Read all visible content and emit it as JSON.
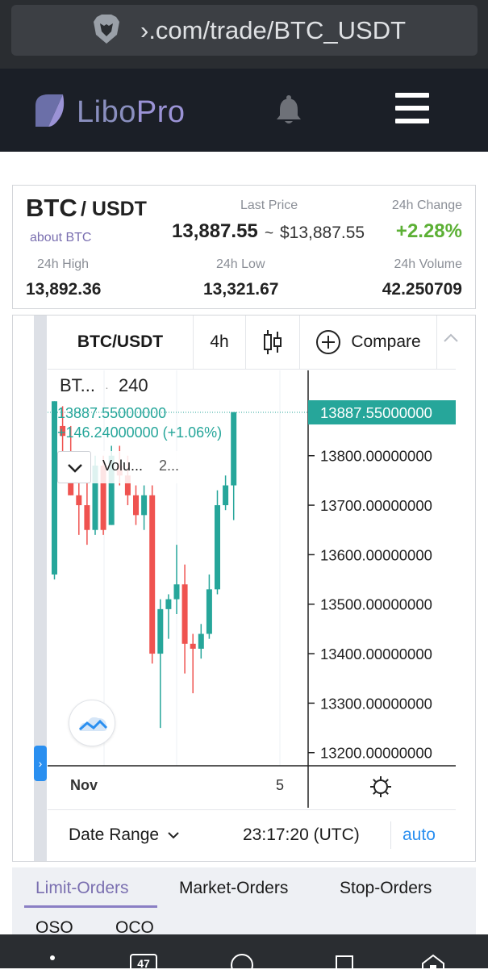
{
  "browser": {
    "url": "›.com/trade/BTC_USDT"
  },
  "site": {
    "logo_main": "Libo",
    "logo_accent": "Pro"
  },
  "ticker": {
    "base": "BTC",
    "quote": "/ USDT",
    "about": "about BTC",
    "last_price_label": "Last Price",
    "last_price": "13,887.55",
    "tilde": "~",
    "usd_price": "$13,887.55",
    "change_label": "24h Change",
    "change": "+2.28%",
    "high_label": "24h High",
    "high": "13,892.36",
    "low_label": "24h Low",
    "low": "13,321.67",
    "volume_label": "24h Volume",
    "volume": "42.250709"
  },
  "chart_toolbar": {
    "symbol": "BTC/USDT",
    "interval": "4h",
    "compare": "Compare"
  },
  "chart_legend": {
    "symbol_short": "BT...",
    "interval": "240",
    "price": "13887.55000000",
    "change": "+146.24000000 (+1.06%)",
    "volume_label": "Volu...",
    "volume_value": "2..."
  },
  "chart_data": {
    "type": "candlestick",
    "price_tag": "13887.55000000",
    "y_ticks": [
      "13800.00000000",
      "13700.00000000",
      "13600.00000000",
      "13500.00000000",
      "13400.00000000",
      "13300.00000000",
      "13200.00000000"
    ],
    "x_ticks": [
      "Nov",
      "5"
    ],
    "ylim": [
      13180,
      13930
    ],
    "candles": [
      {
        "o": 13560,
        "h": 13910,
        "l": 13550,
        "c": 13910
      },
      {
        "o": 13860,
        "h": 13900,
        "l": 13800,
        "c": 13840
      },
      {
        "o": 13790,
        "h": 13860,
        "l": 13720,
        "c": 13720
      },
      {
        "o": 13720,
        "h": 13760,
        "l": 13640,
        "c": 13700
      },
      {
        "o": 13700,
        "h": 13760,
        "l": 13620,
        "c": 13650
      },
      {
        "o": 13650,
        "h": 13800,
        "l": 13640,
        "c": 13780
      },
      {
        "o": 13780,
        "h": 13800,
        "l": 13640,
        "c": 13650
      },
      {
        "o": 13660,
        "h": 13820,
        "l": 13660,
        "c": 13800
      },
      {
        "o": 13780,
        "h": 13820,
        "l": 13740,
        "c": 13760
      },
      {
        "o": 13760,
        "h": 13800,
        "l": 13700,
        "c": 13720
      },
      {
        "o": 13720,
        "h": 13740,
        "l": 13660,
        "c": 13680
      },
      {
        "o": 13680,
        "h": 13740,
        "l": 13650,
        "c": 13720
      },
      {
        "o": 13720,
        "h": 13740,
        "l": 13380,
        "c": 13400
      },
      {
        "o": 13400,
        "h": 13510,
        "l": 13250,
        "c": 13490
      },
      {
        "o": 13490,
        "h": 13520,
        "l": 13430,
        "c": 13510
      },
      {
        "o": 13510,
        "h": 13620,
        "l": 13480,
        "c": 13540
      },
      {
        "o": 13540,
        "h": 13580,
        "l": 13360,
        "c": 13420
      },
      {
        "o": 13420,
        "h": 13440,
        "l": 13320,
        "c": 13410
      },
      {
        "o": 13410,
        "h": 13460,
        "l": 13390,
        "c": 13440
      },
      {
        "o": 13440,
        "h": 13560,
        "l": 13430,
        "c": 13530
      },
      {
        "o": 13530,
        "h": 13730,
        "l": 13520,
        "c": 13700
      },
      {
        "o": 13700,
        "h": 13760,
        "l": 13690,
        "c": 13740
      },
      {
        "o": 13740,
        "h": 13888,
        "l": 13670,
        "c": 13888
      }
    ],
    "colors": {
      "up": "#26a69a",
      "down": "#ef5350"
    }
  },
  "date_bar": {
    "range_label": "Date Range",
    "time": "23:17:20 (UTC)",
    "auto": "auto"
  },
  "order_tabs": [
    "Limit-Orders",
    "Market-Orders",
    "Stop-Orders",
    "OSO",
    "OCO"
  ],
  "nav": {
    "tab_count": "47"
  },
  "colors": {
    "accent": "#2a8ff0",
    "positive": "#5cb035",
    "brand": "#9b93d6"
  }
}
